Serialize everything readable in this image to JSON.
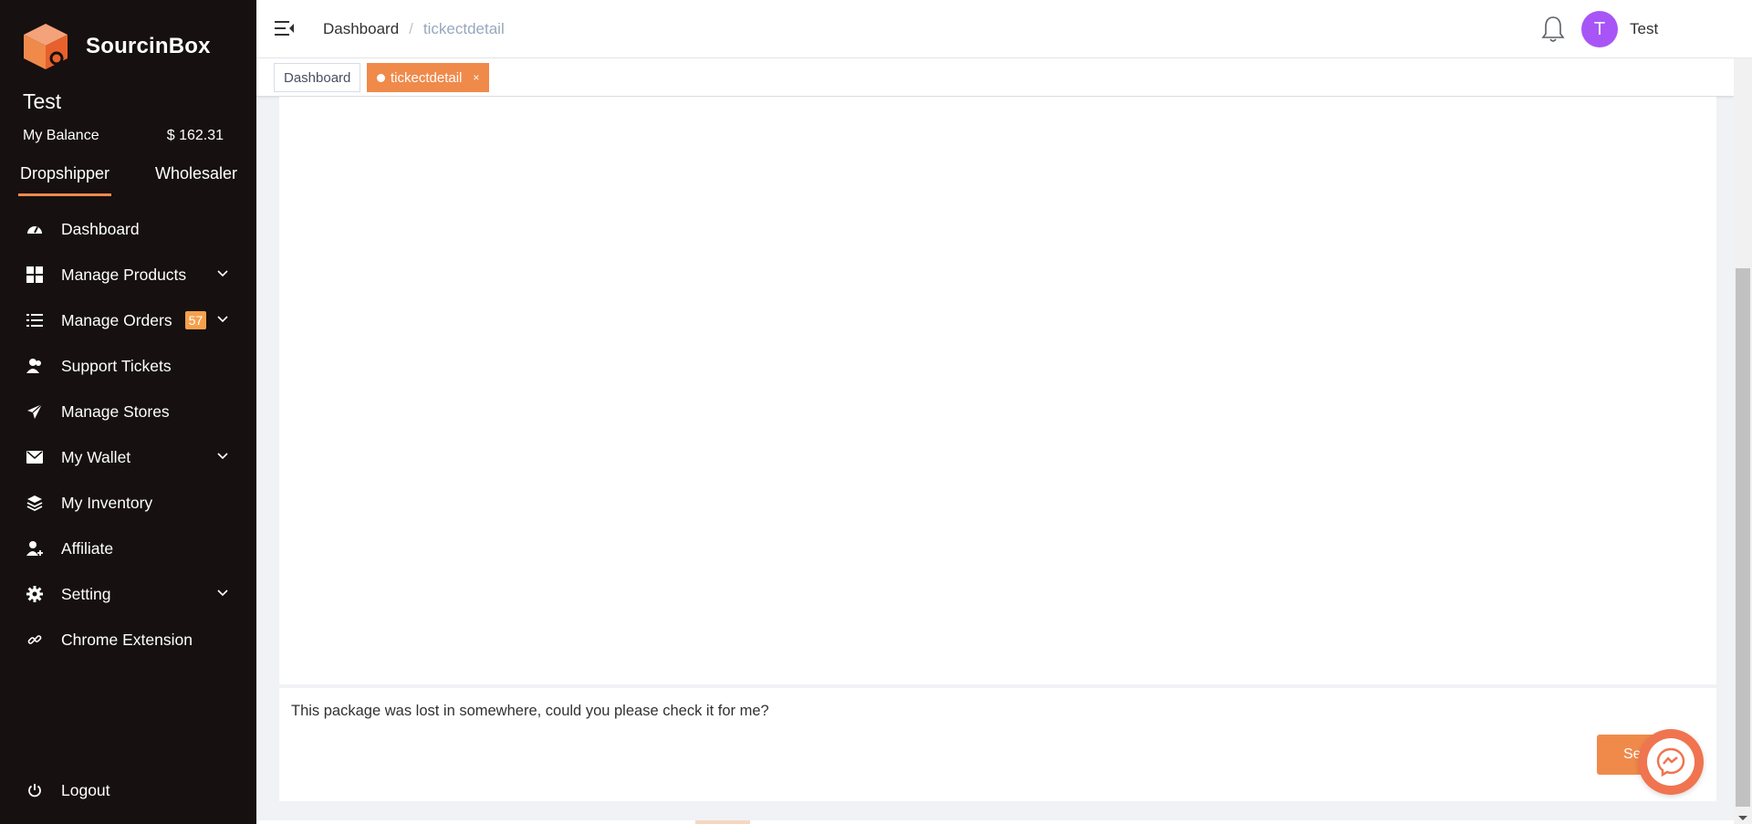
{
  "brand": {
    "name": "SourcinBox",
    "accent": "#f08a4b"
  },
  "user": {
    "name": "Test",
    "balance_label": "My Balance",
    "balance_value": "$ 162.31",
    "avatar_letter": "T"
  },
  "role_tabs": [
    {
      "label": "Dropshipper",
      "active": true
    },
    {
      "label": "Wholesaler",
      "active": false
    }
  ],
  "menu": [
    {
      "label": "Dashboard",
      "icon": "dashboard-icon"
    },
    {
      "label": "Manage Products",
      "icon": "grid-icon",
      "has_submenu": true
    },
    {
      "label": "Manage Orders",
      "icon": "list-icon",
      "has_submenu": true,
      "badge": "57"
    },
    {
      "label": "Support Tickets",
      "icon": "users-icon"
    },
    {
      "label": "Manage Stores",
      "icon": "send-icon"
    },
    {
      "label": "My Wallet",
      "icon": "mail-icon",
      "has_submenu": true
    },
    {
      "label": "My Inventory",
      "icon": "layers-icon"
    },
    {
      "label": "Affiliate",
      "icon": "user-plus-icon"
    },
    {
      "label": "Setting",
      "icon": "gear-icon",
      "has_submenu": true
    },
    {
      "label": "Chrome Extension",
      "icon": "link-icon"
    }
  ],
  "logout": {
    "label": "Logout"
  },
  "header": {
    "breadcrumb": [
      {
        "label": "Dashboard"
      },
      {
        "label": "tickectdetail"
      }
    ],
    "separator": "/",
    "user_name": "Test"
  },
  "tags": [
    {
      "label": "Dashboard",
      "active": false
    },
    {
      "label": "tickectdetail",
      "active": true,
      "close": "×"
    }
  ],
  "message": {
    "text": "This package was lost in somewhere, could you please check it for me?",
    "send_label": "Send"
  }
}
